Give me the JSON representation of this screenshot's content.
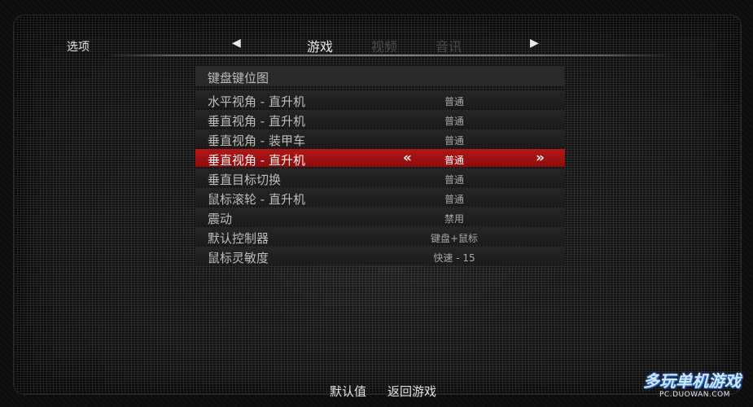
{
  "header": {
    "title": "选项",
    "left_arrow": "◀",
    "right_arrow": "▶",
    "tabs": [
      {
        "label": "游戏",
        "active": true
      },
      {
        "label": "视频",
        "active": false
      },
      {
        "label": "音讯",
        "active": false
      }
    ]
  },
  "list": {
    "header": "键盘键位图",
    "rows": [
      {
        "label": "水平视角 - 直升机",
        "value": "普通"
      },
      {
        "label": "垂直视角 - 直升机",
        "value": "普通"
      },
      {
        "label": "垂直视角 - 装甲车",
        "value": "普通"
      },
      {
        "label": "垂直视角 - 直升机",
        "value": "普通",
        "selected": true,
        "left_glyph": "«",
        "right_glyph": "»"
      },
      {
        "label": "垂直目标切换",
        "value": "普通"
      },
      {
        "label": "鼠标滚轮 - 直升机",
        "value": "普通"
      },
      {
        "label": "震动",
        "value": "禁用"
      },
      {
        "label": "默认控制器",
        "value": "键盘+鼠标"
      },
      {
        "label": "鼠标灵敏度",
        "value": "快速 - 15"
      }
    ]
  },
  "footer": {
    "defaults_label": "默认值",
    "back_label": "返回游戏"
  },
  "watermark": {
    "main": "多玩单机游戏",
    "sub": "PC.DUOWAN.COM"
  },
  "colors": {
    "selected_row": "#9e1212",
    "row_bg": "#1f1f1f",
    "accent_line": "#7a858a"
  }
}
